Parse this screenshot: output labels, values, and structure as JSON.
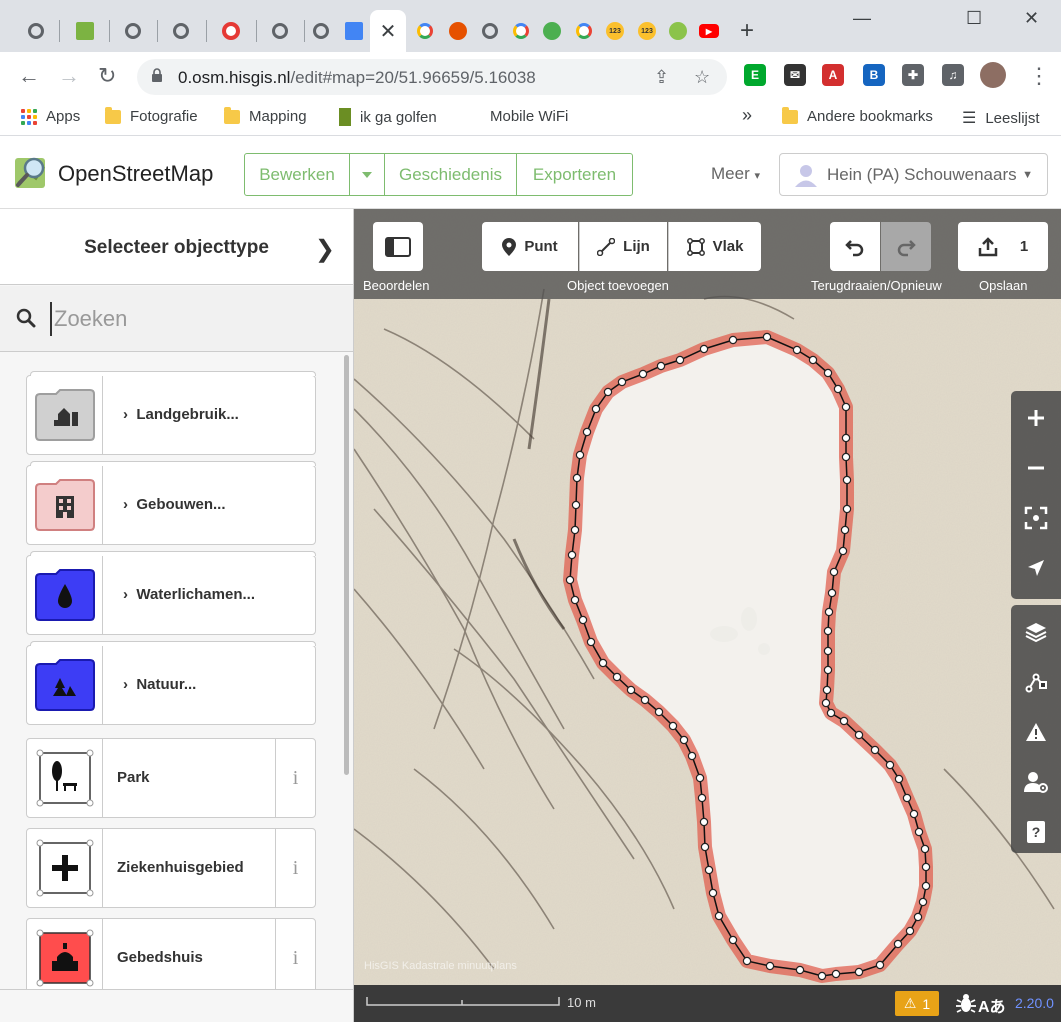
{
  "browser": {
    "tabs": [
      {
        "icon": "globe-icon",
        "color": "#5f6368"
      },
      {
        "icon": "green-square-icon",
        "color": "#7cb342"
      },
      {
        "icon": "globe-icon",
        "color": "#5f6368"
      },
      {
        "icon": "globe-icon",
        "color": "#5f6368"
      },
      {
        "icon": "ring-icon",
        "color": "#e53935"
      },
      {
        "icon": "globe-icon",
        "color": "#5f6368"
      },
      {
        "icon": "chrome-icon",
        "color": "#5f6368"
      },
      {
        "icon": "docs-icon",
        "color": "#4285f4"
      },
      {
        "icon": "google-icon",
        "color": "#4285f4"
      },
      {
        "icon": "horse-icon",
        "color": "#e65100"
      },
      {
        "icon": "globe-icon",
        "color": "#5f6368"
      },
      {
        "icon": "google-icon",
        "color": "#4285f4"
      },
      {
        "icon": "green-circle-icon",
        "color": "#4caf50"
      },
      {
        "icon": "google-icon",
        "color": "#4285f4"
      },
      {
        "icon": "badge-123-icon",
        "color": "#fbc02d"
      },
      {
        "icon": "badge-123-icon",
        "color": "#fbc02d"
      },
      {
        "icon": "frog-icon",
        "color": "#8bc34a"
      },
      {
        "icon": "youtube-icon",
        "color": "#ff0000"
      }
    ],
    "active_tab_close": "✕",
    "new_tab": "+",
    "window_controls": {
      "minimize": "—",
      "maximize": "☐",
      "close": "✕"
    },
    "url_host": "0.osm.hisgis.nl",
    "url_path": "/edit#map=20/51.96659/5.16038",
    "bookmarks": {
      "apps": "Apps",
      "items": [
        "Fotografie",
        "Mapping",
        "ik ga golfen",
        "Mobile WiFi"
      ],
      "overflow": "»",
      "other": "Andere bookmarks",
      "reading_list": "Leeslijst"
    }
  },
  "osm": {
    "title": "OpenStreetMap",
    "nav": {
      "edit": "Bewerken",
      "history": "Geschiedenis",
      "export": "Exporteren"
    },
    "more": "Meer",
    "user": "Hein (PA) Schouwenaars"
  },
  "sidebar": {
    "title": "Selecteer objecttype",
    "search_placeholder": "Zoeken",
    "presets": [
      {
        "label": "Landgebruik...",
        "type": "category",
        "icon": "landuse-folder-icon",
        "color": "#d0d0d0"
      },
      {
        "label": "Gebouwen...",
        "type": "category",
        "icon": "building-folder-icon",
        "color": "#f4cccc"
      },
      {
        "label": "Waterlichamen...",
        "type": "category",
        "icon": "water-folder-icon",
        "color": "#3d3df5"
      },
      {
        "label": "Natuur...",
        "type": "category",
        "icon": "nature-folder-icon",
        "color": "#3d3df5"
      },
      {
        "label": "Park",
        "type": "preset",
        "icon": "park-icon"
      },
      {
        "label": "Ziekenhuisgebied",
        "type": "preset",
        "icon": "hospital-icon"
      },
      {
        "label": "Gebedshuis",
        "type": "preset",
        "icon": "place-of-worship-icon",
        "color": "#ff4d4d"
      }
    ],
    "info_glyph": "i"
  },
  "map": {
    "toolbar": {
      "review_label": "Beoordelen",
      "point": "Punt",
      "line": "Lijn",
      "area": "Vlak",
      "add_label": "Object toevoegen",
      "undo_label": "Terugdraaien/Opnieuw",
      "save_count": "1",
      "save_label": "Opslaan"
    },
    "attribution": "HisGIS Kadastrale minuutplans",
    "scale": "10 m",
    "issues_count": "1",
    "version": "2.20.0",
    "selection_color": "#e06050"
  }
}
